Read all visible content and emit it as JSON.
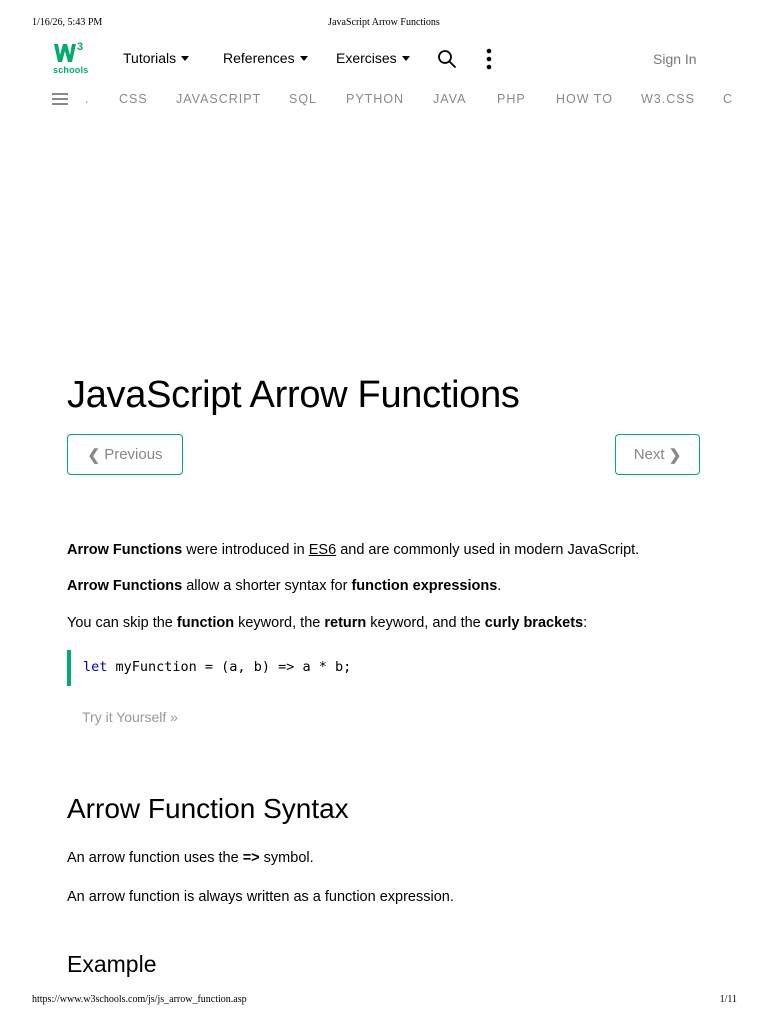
{
  "print_header": {
    "datetime": "1/16/26, 5:43 PM",
    "doc_title": "JavaScript Arrow Functions"
  },
  "topbar": {
    "logo_superscript": "3",
    "logo_text": "schools",
    "menus": [
      {
        "label": "Tutorials"
      },
      {
        "label": "References"
      },
      {
        "label": "Exercises"
      }
    ],
    "search_icon": "search-icon",
    "more_icon": "more-vertical-icon",
    "signin_label": "Sign In"
  },
  "subnav": {
    "menu_icon": "hamburger-icon",
    "items": [
      {
        "label": "."
      },
      {
        "label": "CSS"
      },
      {
        "label": "JAVASCRIPT"
      },
      {
        "label": "SQL"
      },
      {
        "label": "PYTHON"
      },
      {
        "label": "JAVA"
      },
      {
        "label": "PHP"
      },
      {
        "label": "HOW TO"
      },
      {
        "label": "W3.CSS"
      },
      {
        "label": "C"
      }
    ]
  },
  "main": {
    "title": "JavaScript Arrow Functions",
    "prev_label": "Previous",
    "next_label": "Next",
    "intro": {
      "p1": {
        "b1": "Arrow Functions",
        "t1": " were introduced in ",
        "link": "ES6",
        "t2": " and are commonly used in modern JavaScript."
      },
      "p2": {
        "b1": "Arrow Functions",
        "t1": " allow a shorter syntax for ",
        "b2": "function expressions",
        "t2": "."
      },
      "p3": {
        "t0": "You can skip the ",
        "b1": "function",
        "t1": " keyword, the ",
        "b2": "return",
        "t2": " keyword, and the ",
        "b3": "curly brackets",
        "t3": ":"
      }
    },
    "code": {
      "keyword": "let",
      "rest": " myFunction = (a, b) => a * b;"
    },
    "try_label": "Try it Yourself »",
    "syntax_heading": "Arrow Function Syntax",
    "syntax_p1": {
      "t0": "An arrow function uses the ",
      "b1": "=>",
      "t1": " symbol."
    },
    "syntax_p2": "An arrow function is always written as a function expression.",
    "example_heading": "Example"
  },
  "print_footer": {
    "url": "https://www.w3schools.com/js/js_arrow_function.asp",
    "page": "1/11"
  },
  "colors": {
    "accent": "#04AA6D",
    "muted": "#888888",
    "keyword": "#0000cd"
  }
}
